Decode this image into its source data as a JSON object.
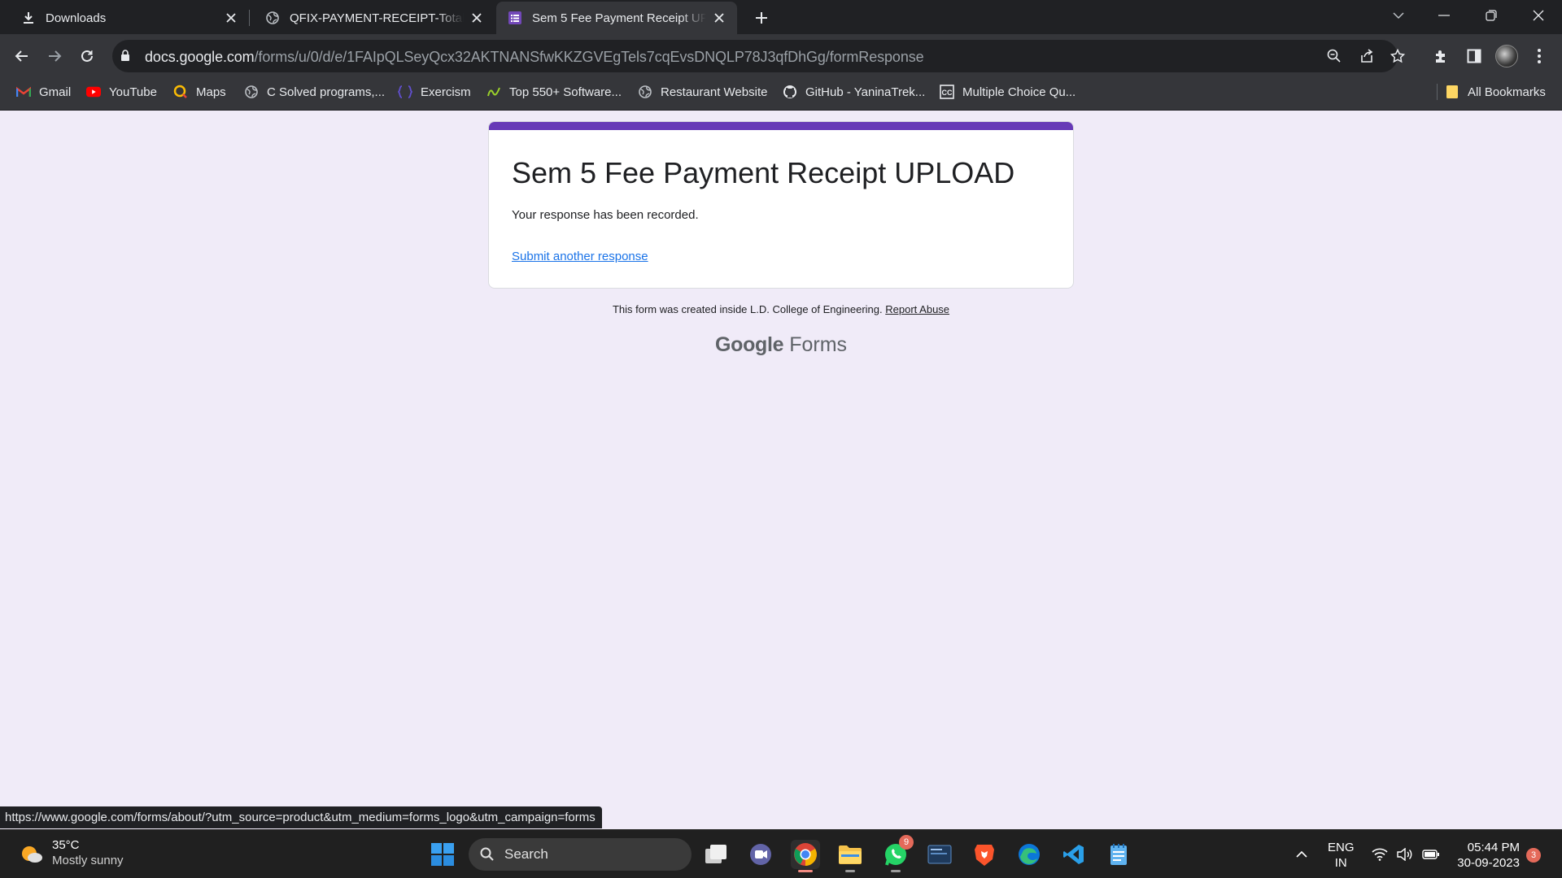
{
  "browser": {
    "tabs": [
      {
        "title": "Downloads",
        "icon": "download-icon"
      },
      {
        "title": "QFIX-PAYMENT-RECEIPT-Total Fees",
        "icon": "globe-icon"
      },
      {
        "title": "Sem 5 Fee Payment Receipt UPLOAD",
        "icon": "forms-icon",
        "active": true
      }
    ],
    "url_host": "docs.google.com",
    "url_path": "/forms/u/0/d/e/1FAIpQLSeyQcx32AKTNANSfwKKZGVEgTels7cqEvsDNQLP78J3qfDhGg/formResponse",
    "bookmarks": [
      {
        "label": "Gmail",
        "icon": "gmail-icon"
      },
      {
        "label": "YouTube",
        "icon": "youtube-icon"
      },
      {
        "label": "Maps",
        "icon": "maps-icon"
      },
      {
        "label": "C Solved programs,...",
        "icon": "globe-icon"
      },
      {
        "label": "Exercism",
        "icon": "exercism-icon"
      },
      {
        "label": "Top 550+ Software...",
        "icon": "bookmark-site-icon"
      },
      {
        "label": "Restaurant Website",
        "icon": "globe-icon"
      },
      {
        "label": "GitHub - YaninaTrek...",
        "icon": "github-icon"
      },
      {
        "label": "Multiple Choice Qu...",
        "icon": "cc-icon"
      }
    ],
    "all_bookmarks_label": "All Bookmarks",
    "status_url": "https://www.google.com/forms/about/?utm_source=product&utm_medium=forms_logo&utm_campaign=forms"
  },
  "form": {
    "title": "Sem 5 Fee Payment Receipt UPLOAD",
    "message": "Your response has been recorded.",
    "submit_another": "Submit another response",
    "footer_text": "This form was created inside L.D. College of Engineering.",
    "report_abuse": "Report Abuse",
    "logo_google": "Google",
    "logo_forms": "Forms",
    "accent_color": "#673ab7"
  },
  "taskbar": {
    "weather_temp": "35°C",
    "weather_desc": "Mostly sunny",
    "search_label": "Search",
    "whatsapp_badge": "9",
    "lang_top": "ENG",
    "lang_bottom": "IN",
    "time": "05:44 PM",
    "date": "30-09-2023",
    "notifications": "3"
  }
}
